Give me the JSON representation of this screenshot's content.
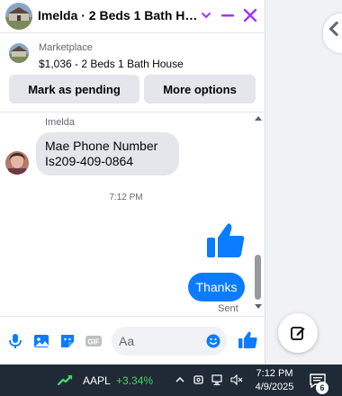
{
  "header": {
    "title": "Imelda · 2 Beds 1 Bath Hou…"
  },
  "listing": {
    "label": "Marketplace",
    "description": "$1,036 - 2 Beds 1 Bath House",
    "mark_pending_label": "Mark as pending",
    "more_options_label": "More options"
  },
  "messages": {
    "sender_name": "Imelda",
    "incoming_line1": "Mae Phone Number",
    "incoming_line2": "Is209-409-0864",
    "timestamp": "7:12 PM",
    "outgoing_text": "Thanks",
    "status": "Sent"
  },
  "composer": {
    "placeholder": "Aa"
  },
  "taskbar": {
    "ticker": "AAPL",
    "change": "+3.34%",
    "time": "7:12 PM",
    "date": "4/9/2025",
    "notification_count": "6"
  },
  "colors": {
    "accent": "#0a7cff",
    "header_icons": "#a033ff",
    "stock_positive": "#45d46a"
  }
}
